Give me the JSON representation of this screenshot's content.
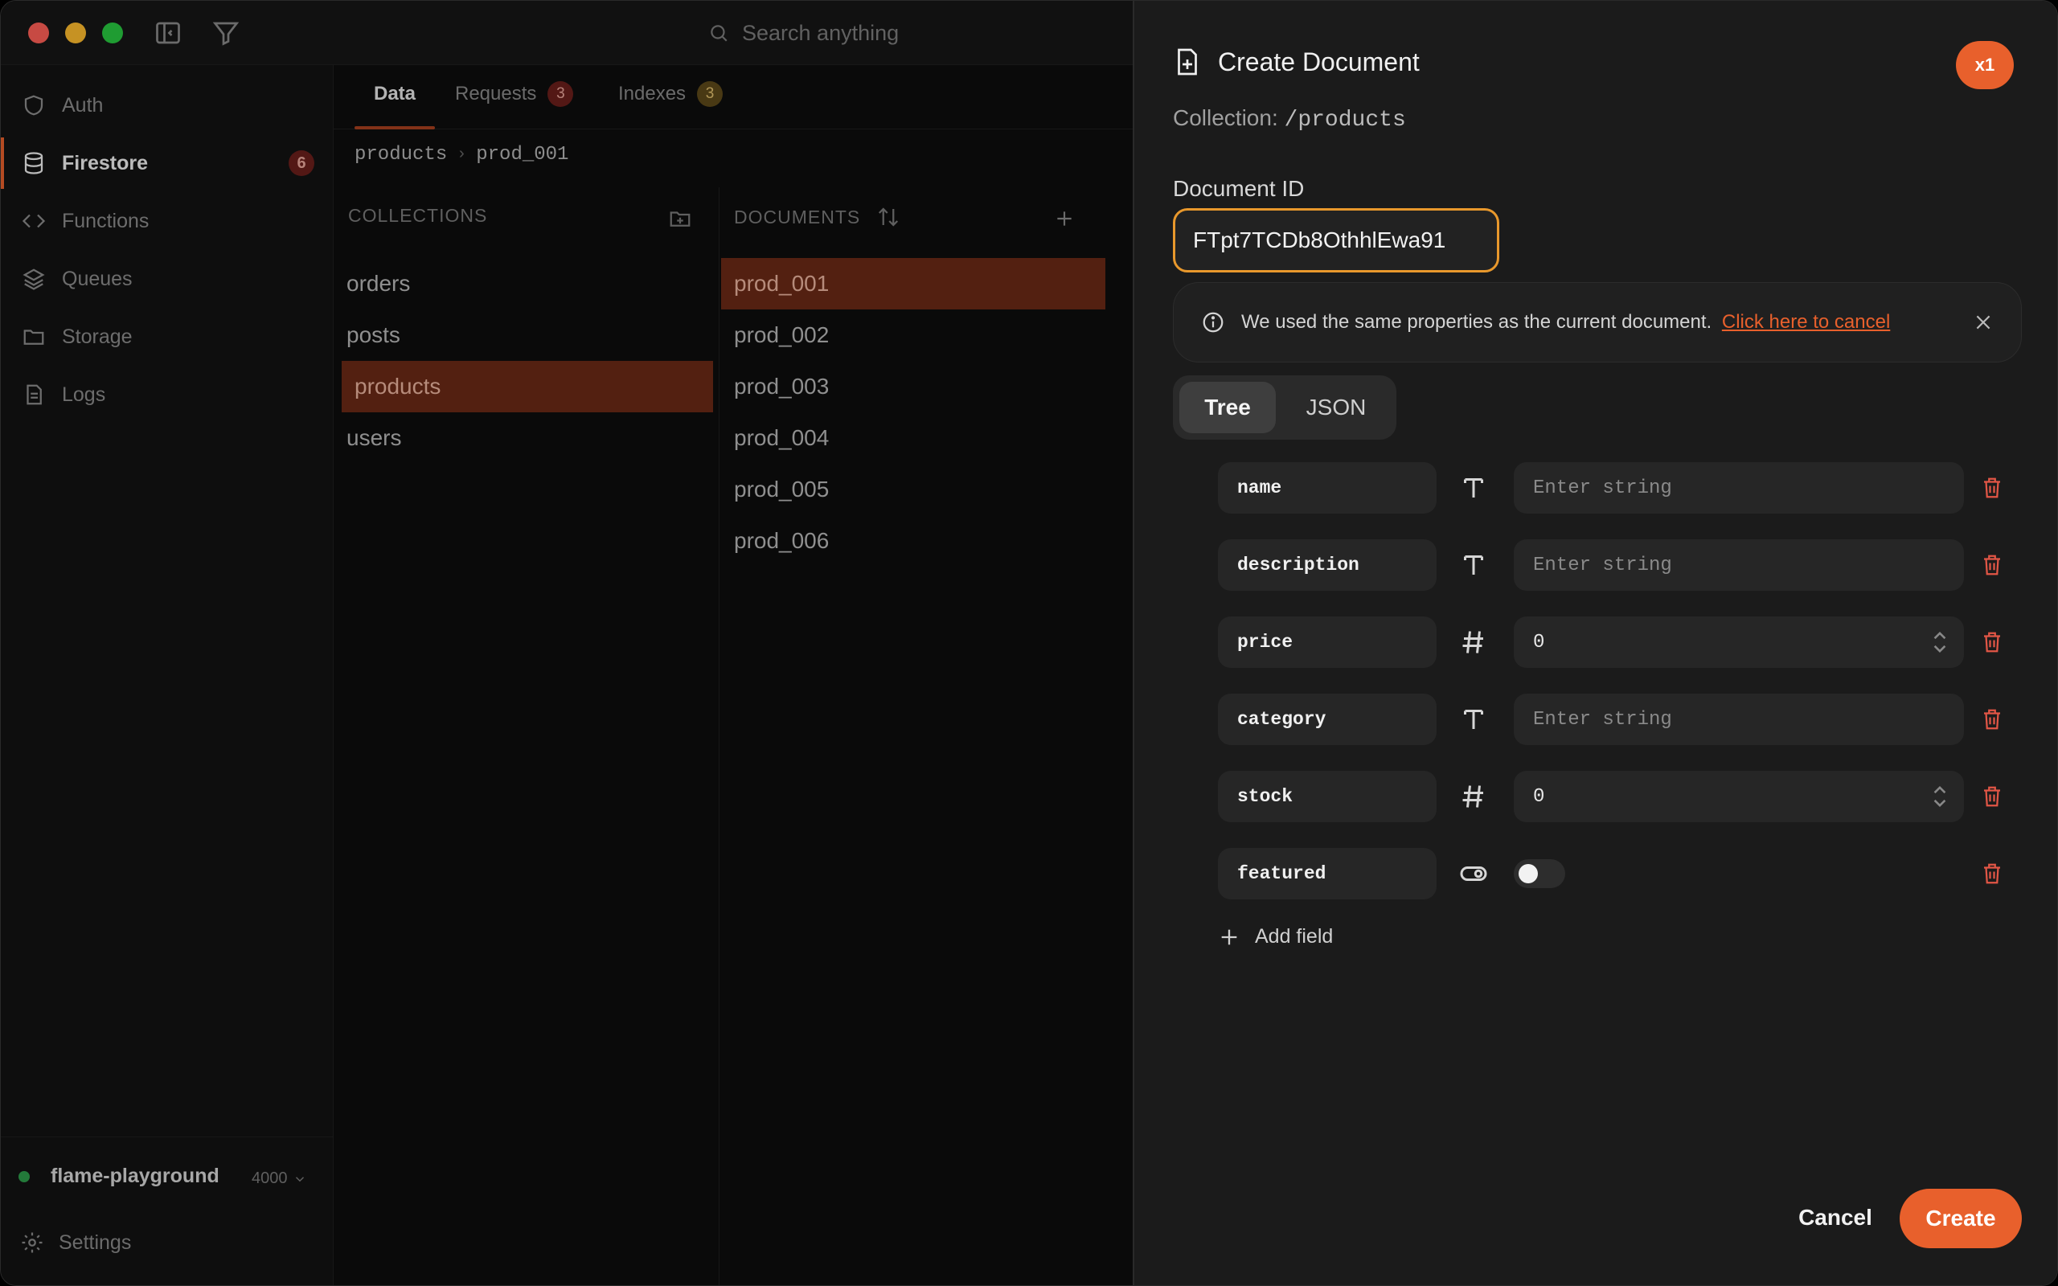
{
  "titlebar": {
    "search_placeholder": "Search anything",
    "icons": [
      "sidebar-toggle-icon",
      "filter-icon",
      "search-icon"
    ]
  },
  "sidebar": {
    "items": [
      {
        "label": "Auth",
        "icon": "shield-icon"
      },
      {
        "label": "Firestore",
        "icon": "database-icon",
        "badge": "6",
        "active": true
      },
      {
        "label": "Functions",
        "icon": "code-icon"
      },
      {
        "label": "Queues",
        "icon": "layers-icon"
      },
      {
        "label": "Storage",
        "icon": "folder-icon"
      },
      {
        "label": "Logs",
        "icon": "document-icon"
      }
    ],
    "project": "flame-playground",
    "port": "4000",
    "settings_label": "Settings"
  },
  "main": {
    "tabs": [
      {
        "label": "Data",
        "active": true
      },
      {
        "label": "Requests",
        "badge": "3"
      },
      {
        "label": "Indexes",
        "badge": "3"
      }
    ],
    "breadcrumb": [
      "products",
      "prod_001"
    ],
    "collections": {
      "header": "COLLECTIONS",
      "items": [
        "orders",
        "posts",
        "products",
        "users"
      ],
      "selected": "products"
    },
    "documents": {
      "header": "DOCUMENTS",
      "items": [
        "prod_001",
        "prod_002",
        "prod_003",
        "prod_004",
        "prod_005",
        "prod_006"
      ],
      "selected": "prod_001"
    }
  },
  "drawer": {
    "title": "Create Document",
    "count_badge": "x1",
    "collection_label": "Collection:",
    "collection_path": "/products",
    "docid_label": "Document ID",
    "docid_value": "FTpt7TCDb8OthhlEwa91",
    "notice_text": "We used the same properties as the current document.",
    "notice_link": "Click here to cancel",
    "view_tabs": [
      "Tree",
      "JSON"
    ],
    "active_view": "Tree",
    "fields": [
      {
        "name": "name",
        "type": "string",
        "placeholder": "Enter string"
      },
      {
        "name": "description",
        "type": "string",
        "placeholder": "Enter string"
      },
      {
        "name": "price",
        "type": "number",
        "value": "0"
      },
      {
        "name": "category",
        "type": "string",
        "placeholder": "Enter string"
      },
      {
        "name": "stock",
        "type": "number",
        "value": "0"
      },
      {
        "name": "featured",
        "type": "boolean",
        "value": false
      }
    ],
    "add_field_label": "Add field",
    "cancel_label": "Cancel",
    "create_label": "Create",
    "accent_color": "#e8602c"
  }
}
